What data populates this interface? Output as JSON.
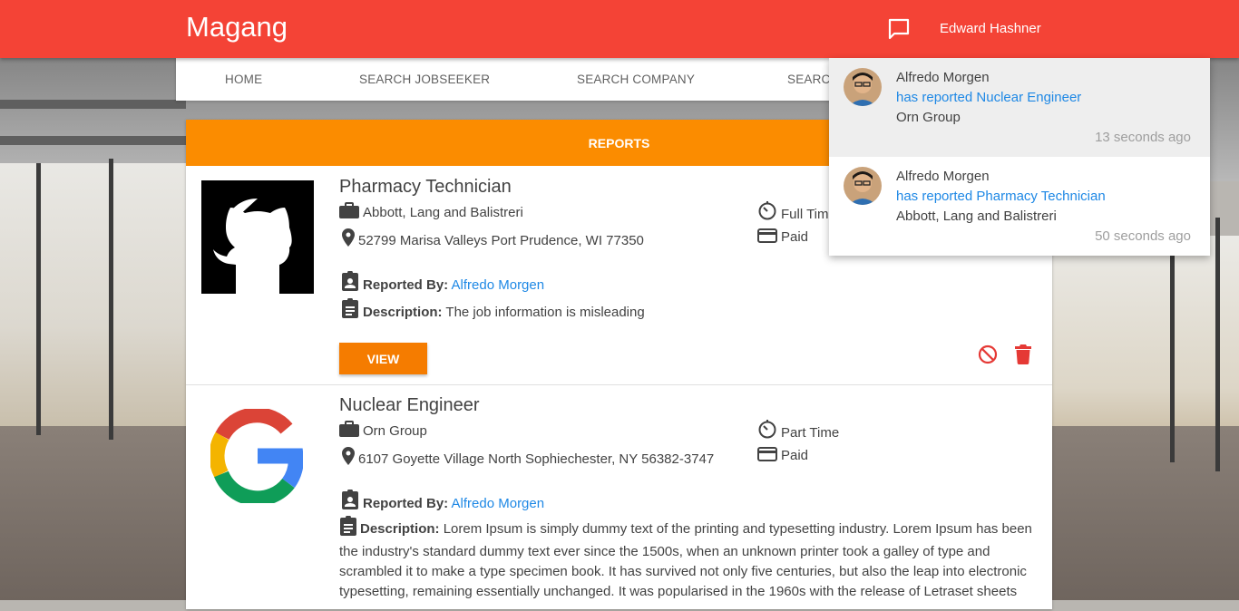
{
  "app": {
    "brand": "Magang",
    "user_name": "Edward Hashner"
  },
  "nav": {
    "items": [
      {
        "label": "HOME"
      },
      {
        "label": "SEARCH JOBSEEKER"
      },
      {
        "label": "SEARCH COMPANY"
      },
      {
        "label": "SEARCH"
      }
    ]
  },
  "reports": {
    "header": "REPORTS",
    "items": [
      {
        "title": "Pharmacy Technician",
        "company": "Abbott, Lang and Balistreri",
        "address": "52799 Marisa Valleys Port Prudence, WI 77350",
        "job_type": "Full Time",
        "pay": "Paid",
        "reported_by_label": "Reported By:",
        "reported_by": "Alfredo Morgen",
        "description_label": "Description:",
        "description": "The job information is misleading",
        "view_label": "VIEW",
        "logo_icon": "github-icon"
      },
      {
        "title": "Nuclear Engineer",
        "company": "Orn Group",
        "address": "6107 Goyette Village North Sophiechester, NY 56382-3747",
        "job_type": "Part Time",
        "pay": "Paid",
        "reported_by_label": "Reported By:",
        "reported_by": "Alfredo Morgen",
        "description_label": "Description:",
        "description": "Lorem Ipsum is simply dummy text of the printing and typesetting industry. Lorem Ipsum has been the industry's standard dummy text ever since the 1500s, when an unknown printer took a galley of type and scrambled it to make a type specimen book. It has survived not only five centuries, but also the leap into electronic typesetting, remaining essentially unchanged. It was popularised in the 1960s with the release of Letraset sheets",
        "logo_icon": "google-icon"
      }
    ]
  },
  "notifications": [
    {
      "name": "Alfredo Morgen",
      "action": "has reported Nuclear Engineer",
      "company": "Orn Group",
      "time": "13 seconds ago",
      "highlighted": true
    },
    {
      "name": "Alfredo Morgen",
      "action": "has reported Pharmacy Technician",
      "company": "Abbott, Lang and Balistreri",
      "time": "50 seconds ago",
      "highlighted": false
    }
  ],
  "colors": {
    "appbar": "#f44336",
    "reports_header": "#fb8c00",
    "view_button": "#f57c00",
    "link": "#1e88e5",
    "danger": "#e53935"
  }
}
